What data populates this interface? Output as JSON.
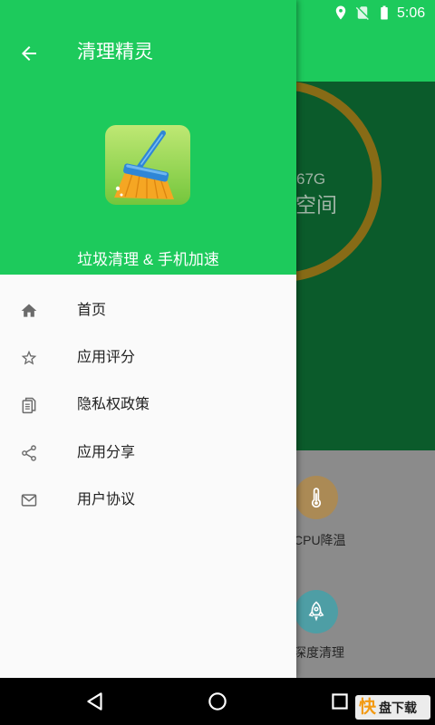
{
  "status_bar": {
    "time": "5:06",
    "icons": [
      "location-icon",
      "no-sim-icon",
      "battery-icon"
    ]
  },
  "app_bar": {
    "title": "清理精灵",
    "back_icon": "arrow-back-icon"
  },
  "drawer": {
    "header": {
      "app_icon": "broom-app-icon",
      "tagline": "垃圾清理 & 手机加速"
    },
    "items": [
      {
        "label": "首页",
        "icon": "home-icon"
      },
      {
        "label": "应用评分",
        "icon": "star-icon"
      },
      {
        "label": "隐私权政策",
        "icon": "document-icon"
      },
      {
        "label": "应用分享",
        "icon": "share-icon"
      },
      {
        "label": "用户协议",
        "icon": "mail-icon"
      }
    ]
  },
  "main": {
    "storage": {
      "size": "67G",
      "label": "空间"
    },
    "tools": [
      {
        "label": "CPU降温",
        "icon": "thermometer-icon"
      },
      {
        "label": "深度清理",
        "icon": "rocket-icon"
      }
    ]
  },
  "nav_bar": {
    "icons": [
      "back-triangle-icon",
      "home-circle-icon",
      "recents-square-icon"
    ]
  },
  "watermark": {
    "mark": "快",
    "text": "盘下载"
  },
  "colors": {
    "primary": "#1DCA5C",
    "hero_dimmed": "#0B5B2B",
    "ring_dimmed": "#876B16",
    "tools_bg_dimmed": "#8B8B8B",
    "cpu_circle": "#AB8A55",
    "deep_clean_circle": "#4E9EA5",
    "drawer_bg": "#FAFAFA",
    "menu_icon": "#6B6B6B"
  }
}
